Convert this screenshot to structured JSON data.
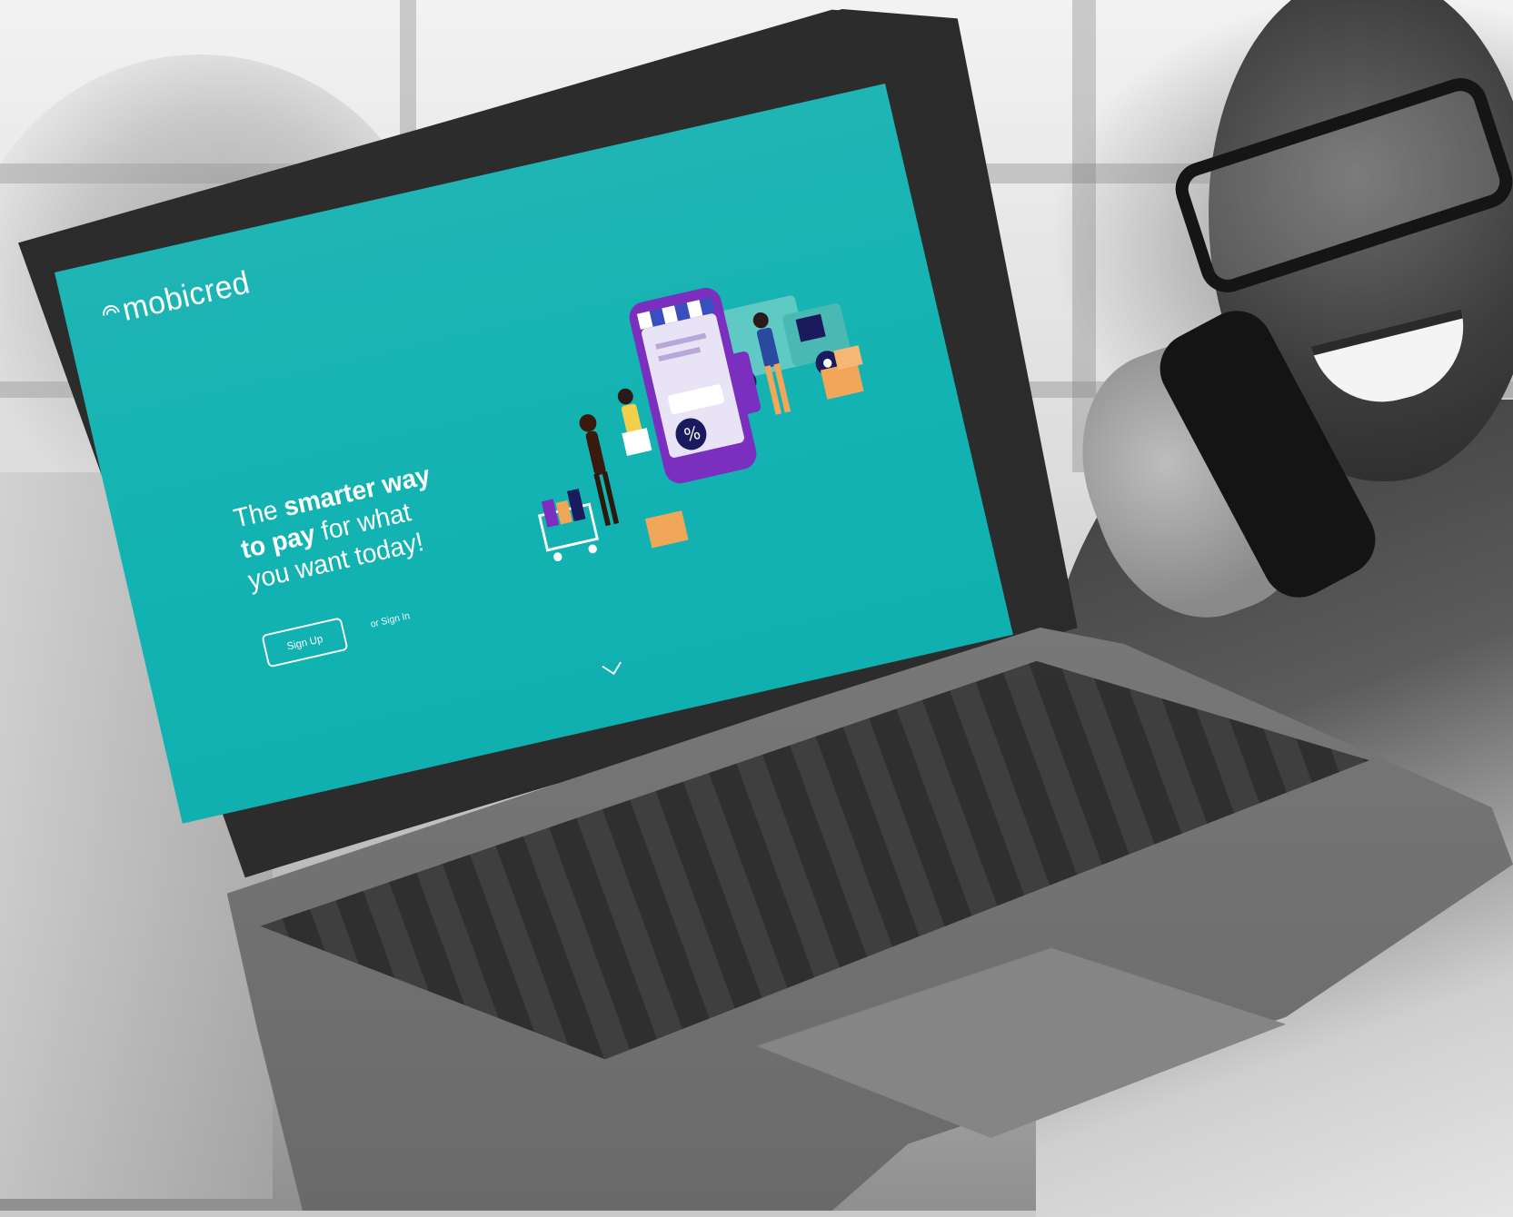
{
  "brand": {
    "name": "mobicred",
    "accent": "#13b3b2",
    "illustration_purple": "#7a2fbf"
  },
  "hero": {
    "headline_prefix": "The ",
    "headline_bold_1": "smarter way",
    "headline_bold_2": "to pay",
    "headline_rest_1": " for what",
    "headline_rest_2": "you want today!"
  },
  "actions": {
    "signup_label": "Sign Up",
    "signin_label": "or Sign In"
  },
  "icons": {
    "scroll": "chevron-down-icon",
    "illustration": "shopping-illustration",
    "logo_mark": "wifi-signal-icon"
  },
  "illustration": {
    "discount_label": "%"
  }
}
